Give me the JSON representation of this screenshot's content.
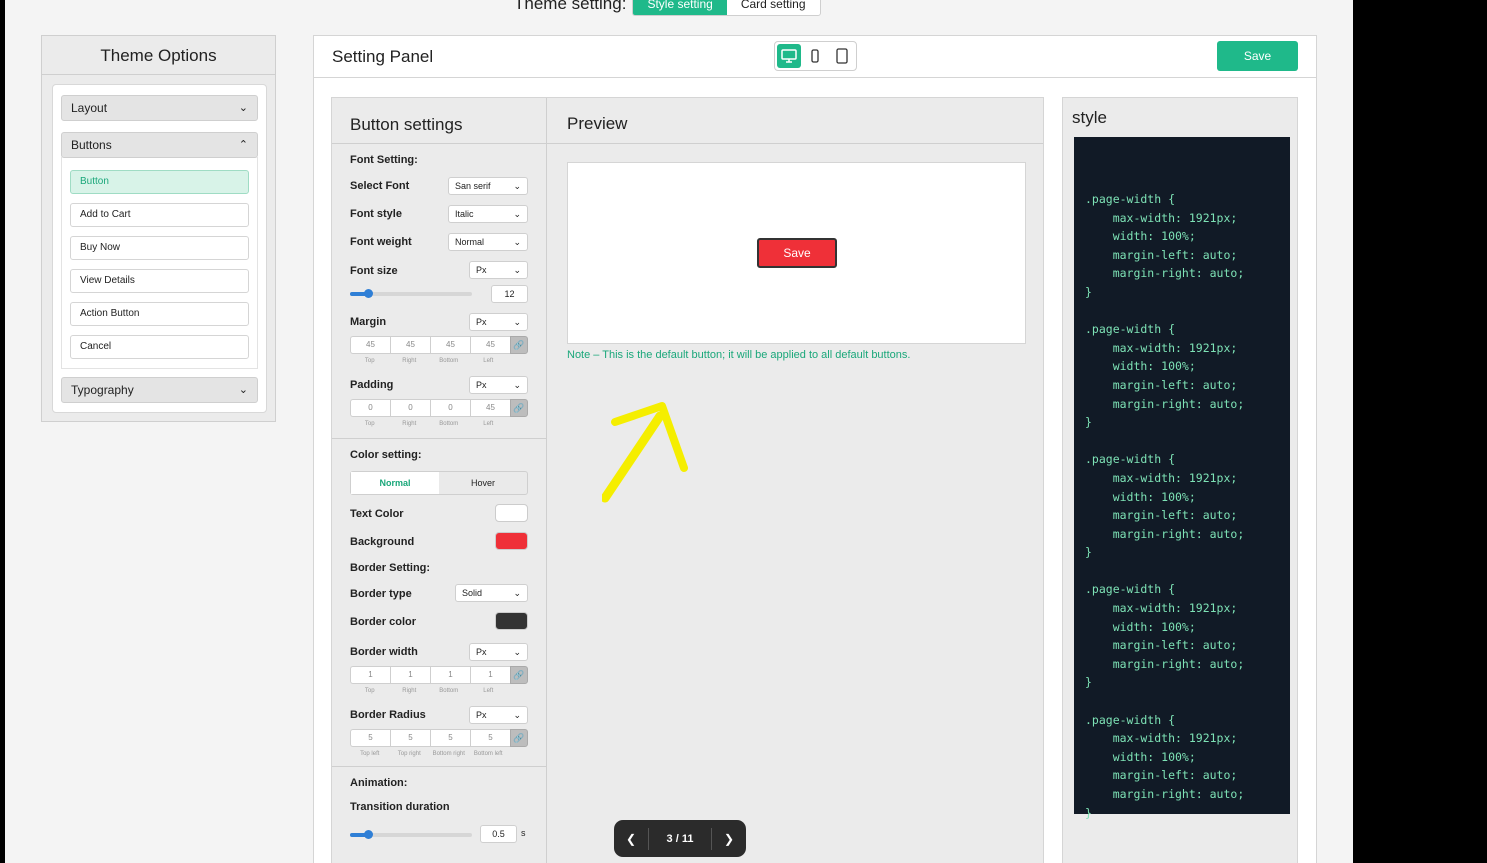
{
  "theme_bar": {
    "label": "Theme setting:",
    "tabs": [
      "Style setting",
      "Card setting"
    ],
    "active_tab": "Style setting"
  },
  "sidebar": {
    "title": "Theme Options",
    "sections": [
      "Layout",
      "Buttons",
      "Typography"
    ],
    "button_items": [
      "Button",
      "Add to Cart",
      "Buy Now",
      "View Details",
      "Action Button",
      "Cancel"
    ],
    "active_item": "Button"
  },
  "panel": {
    "title": "Setting Panel",
    "save_label": "Save",
    "devices": [
      "desktop-icon",
      "mobile-icon",
      "tablet-icon"
    ],
    "active_device": "desktop-icon"
  },
  "button_settings": {
    "title": "Button settings",
    "font_setting": "Font Setting:",
    "select_font": {
      "label": "Select Font",
      "value": "San serif"
    },
    "font_style": {
      "label": "Font style",
      "value": "Italic"
    },
    "font_weight": {
      "label": "Font weight",
      "value": "Normal"
    },
    "font_size": {
      "label": "Font size",
      "unit": "Px",
      "value": "12",
      "slider_fraction": 0.15
    },
    "margin": {
      "label": "Margin",
      "unit": "Px",
      "values": [
        "45",
        "45",
        "45",
        "45"
      ],
      "sides": [
        "Top",
        "Right",
        "Bottom",
        "Left"
      ]
    },
    "padding": {
      "label": "Padding",
      "unit": "Px",
      "values": [
        "0",
        "0",
        "0",
        "45"
      ],
      "sides": [
        "Top",
        "Right",
        "Bottom",
        "Left"
      ]
    },
    "color_setting": "Color setting:",
    "color_tabs": [
      "Normal",
      "Hover"
    ],
    "text_color": {
      "label": "Text Color",
      "value": "#ffffff"
    },
    "background": {
      "label": "Background",
      "value": "#ef3038"
    },
    "border_setting": "Border Setting:",
    "border_type": {
      "label": "Border type",
      "value": "Solid"
    },
    "border_color": {
      "label": "Border color",
      "value": "#333333"
    },
    "border_width": {
      "label": "Border width",
      "unit": "Px",
      "values": [
        "1",
        "1",
        "1",
        "1"
      ],
      "sides": [
        "Top",
        "Right",
        "Bottom",
        "Left"
      ]
    },
    "border_radius": {
      "label": "Border Radius",
      "unit": "Px",
      "values": [
        "5",
        "5",
        "5",
        "5"
      ],
      "sides": [
        "Top left",
        "Top right",
        "Bottom right",
        "Bottom left"
      ]
    },
    "animation": "Animation:",
    "transition": {
      "label": "Transition duration",
      "value": "0.5",
      "unit": "s",
      "slider_fraction": 0.15
    }
  },
  "preview": {
    "title": "Preview",
    "button_label": "Save",
    "note": "Note – This is the default button; it will be applied to all default buttons."
  },
  "style": {
    "title": "style",
    "code": ".page-width {\n    max-width: 1921px;\n    width: 100%;\n    margin-left: auto;\n    margin-right: auto;\n}\n\n.page-width {\n    max-width: 1921px;\n    width: 100%;\n    margin-left: auto;\n    margin-right: auto;\n}\n\n.page-width {\n    max-width: 1921px;\n    width: 100%;\n    margin-left: auto;\n    margin-right: auto;\n}\n\n.page-width {\n    max-width: 1921px;\n    width: 100%;\n    margin-left: auto;\n    margin-right: auto;\n}\n\n.page-width {\n    max-width: 1921px;\n    width: 100%;\n    margin-left: auto;\n    margin-right: auto;\n}"
  },
  "pager": {
    "text": "3 / 11"
  },
  "colors": {
    "accent": "#1fb98a",
    "code_bg": "#111a26",
    "code_text": "#7ee3b6",
    "annotation": "#f5ee00"
  }
}
